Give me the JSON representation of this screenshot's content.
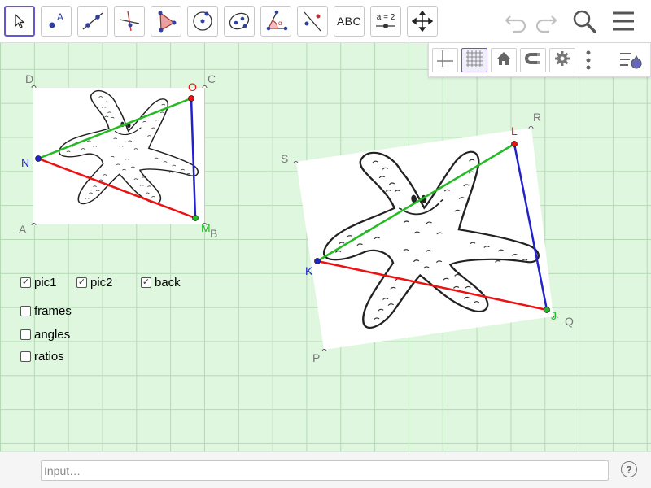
{
  "toolbar": {
    "tools": [
      {
        "name": "move-tool",
        "icon": "arrow-cursor-icon",
        "selected": true
      },
      {
        "name": "point-tool",
        "icon": "point-icon",
        "letter": "A"
      },
      {
        "name": "line-tool",
        "icon": "line-through-points-icon"
      },
      {
        "name": "perpendicular-tool",
        "icon": "perpendicular-line-icon"
      },
      {
        "name": "polygon-tool",
        "icon": "polygon-icon"
      },
      {
        "name": "circle-tool",
        "icon": "circle-with-center-icon"
      },
      {
        "name": "ellipse-tool",
        "icon": "ellipse-icon"
      },
      {
        "name": "angle-tool",
        "icon": "angle-icon",
        "letter": "α"
      },
      {
        "name": "reflect-tool",
        "icon": "reflect-about-line-icon"
      },
      {
        "name": "text-tool",
        "icon": "text-icon",
        "label": "ABC"
      },
      {
        "name": "slider-tool",
        "icon": "slider-icon",
        "label": "a = 2"
      },
      {
        "name": "move-graphics-tool",
        "icon": "move-graphics-view-icon"
      }
    ],
    "right_icons": [
      "undo-icon",
      "redo-icon",
      "search-icon",
      "menu-icon"
    ]
  },
  "style_bar": {
    "buttons": [
      "axes-icon",
      "grid-icon",
      "home-icon",
      "magnet-icon",
      "gear-icon",
      "more-icon",
      "style-bar-toggle-icon"
    ],
    "grid_on": true
  },
  "colors": {
    "background": "#dff7df",
    "grid": "#b5d9b5",
    "green_segment": "#22bb22",
    "red_segment": "#ee1111",
    "blue_segment": "#2222cc",
    "frame_point": "#777777"
  },
  "points": {
    "pic1_frame": [
      "D",
      "C",
      "A",
      "B"
    ],
    "pic1_triangle": [
      "O",
      "N",
      "M"
    ],
    "pic2_frame": [
      "S",
      "R",
      "P",
      "Q"
    ],
    "pic2_triangle": [
      "L",
      "K",
      "J"
    ]
  },
  "checkboxes": [
    {
      "label": "pic1",
      "checked": true
    },
    {
      "label": "pic2",
      "checked": true
    },
    {
      "label": "back",
      "checked": true
    },
    {
      "label": "frames",
      "checked": false
    },
    {
      "label": "angles",
      "checked": false
    },
    {
      "label": "ratios",
      "checked": false
    }
  ],
  "input_bar": {
    "placeholder": "Input…",
    "help": "?"
  }
}
